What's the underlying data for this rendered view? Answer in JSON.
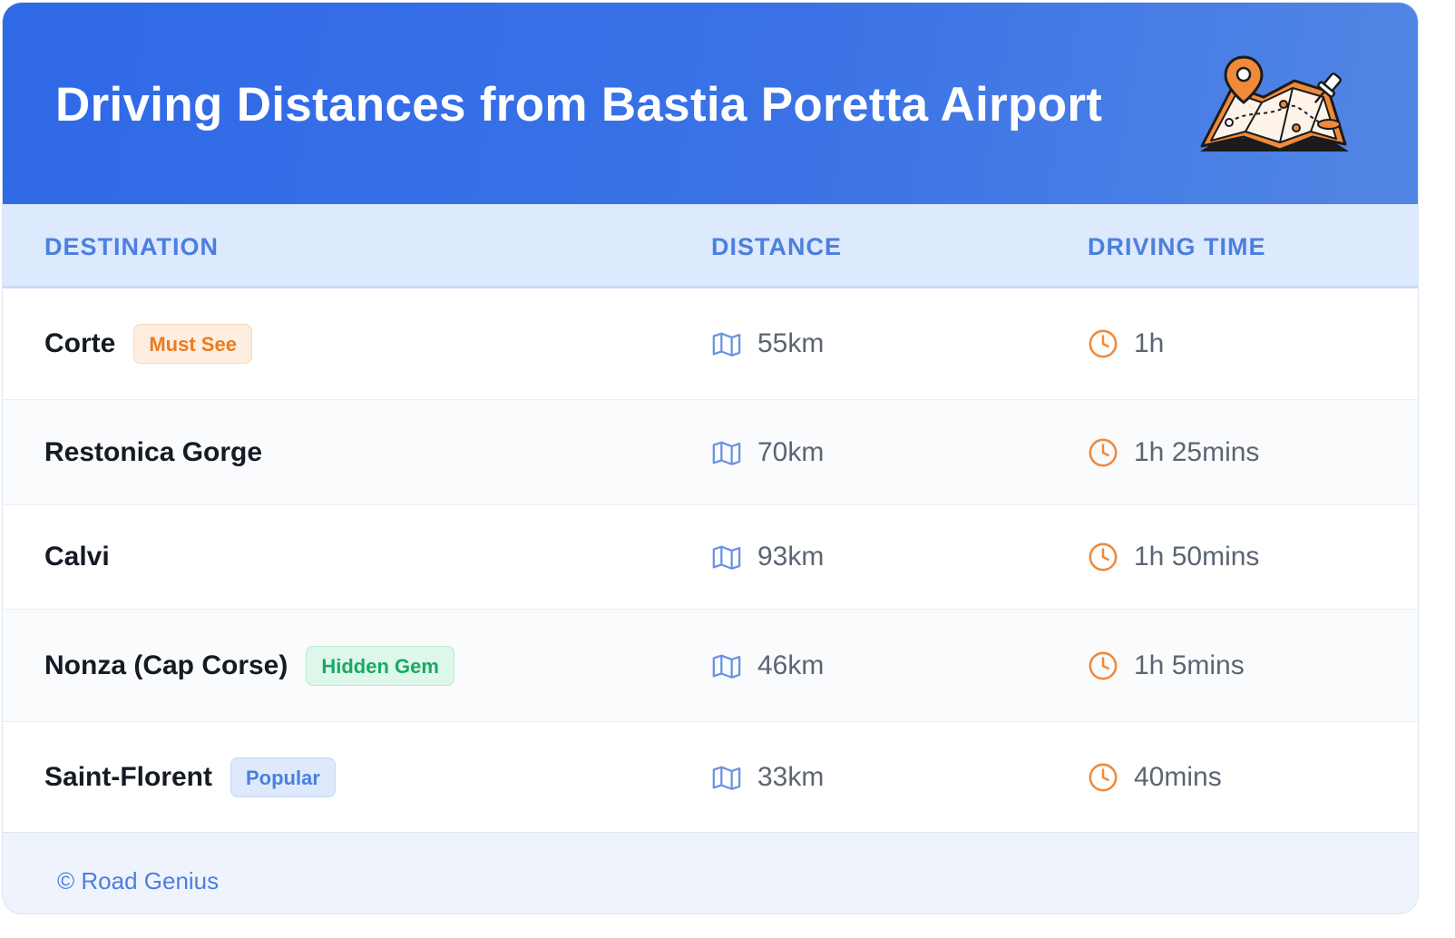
{
  "header": {
    "title": "Driving Distances from Bastia Poretta Airport"
  },
  "table": {
    "columns": [
      "DESTINATION",
      "DISTANCE",
      "DRIVING TIME"
    ],
    "rows": [
      {
        "destination": "Corte",
        "badge": "Must See",
        "badge_color": "#ee7a1d",
        "distance": "55km",
        "time": "1h"
      },
      {
        "destination": "Restonica Gorge",
        "badge": "",
        "distance": "70km",
        "time": "1h 25mins"
      },
      {
        "destination": "Calvi",
        "badge": "",
        "distance": "93km",
        "time": "1h 50mins"
      },
      {
        "destination": "Nonza (Cap Corse)",
        "badge": "Hidden Gem",
        "badge_color": "#1aa865",
        "distance": "46km",
        "time": "1h 5mins"
      },
      {
        "destination": "Saint-Florent",
        "badge": "Popular",
        "badge_color": "#4a7fdf",
        "distance": "33km",
        "time": "40mins"
      }
    ],
    "icons": {
      "distance": "map-icon",
      "time": "clock-icon"
    }
  },
  "footer": {
    "copyright": "© Road Genius"
  },
  "colors": {
    "header_gradient_start": "#2f69e6",
    "header_gradient_end": "#5286e4",
    "accent_blue": "#4c7fdf",
    "accent_orange": "#ee8a3c"
  }
}
